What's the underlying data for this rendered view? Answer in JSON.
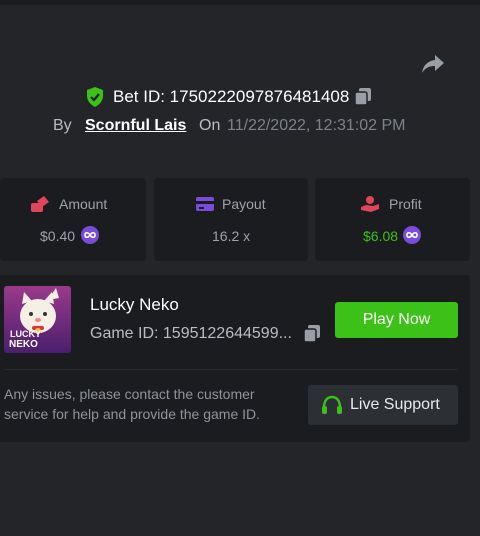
{
  "bet": {
    "id_label": "Bet ID: 1750222097876481408",
    "by_label": "By",
    "user": "Scornful Lais",
    "on_label": "On",
    "date": "11/22/2022, 12:31:02 PM"
  },
  "stats": {
    "amount": {
      "label": "Amount",
      "value": "$0.40"
    },
    "payout": {
      "label": "Payout",
      "value": "16.2 x"
    },
    "profit": {
      "label": "Profit",
      "value": "$6.08"
    }
  },
  "game": {
    "name": "Lucky Neko",
    "id_label": "Game ID: 1595122644599...",
    "thumb_text_line1": "LUCKY",
    "thumb_text_line2": "NEKO",
    "play_label": "Play Now",
    "note": "Any issues, please contact the customer service for help and provide the game ID.",
    "support_label": "Live Support"
  },
  "colors": {
    "accent_green": "#3bc117",
    "profit_green": "#3bc117",
    "coin_purple": "#7b4bd9",
    "amount_icon": "#e0455b",
    "payout_icon": "#7b4bd9",
    "profit_icon": "#e0455b"
  },
  "icons": {
    "share": "share-arrow-icon",
    "shield": "shield-check-icon",
    "copy": "copy-icon",
    "amount": "coins-icon",
    "payout": "card-icon",
    "profit": "hand-coins-icon",
    "coin": "coin-icon",
    "support": "headset-icon"
  }
}
